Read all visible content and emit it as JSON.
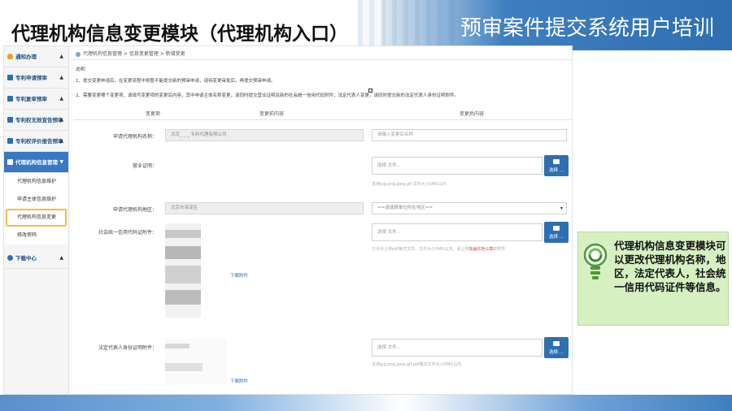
{
  "slide": {
    "title": "代理机构信息变更模块（代理机构入口）",
    "course_title": "预审案件提交系统用户培训"
  },
  "sidebar": {
    "items": [
      {
        "label": "通知办理",
        "icon": "bell-icon"
      },
      {
        "label": "专利申请预审",
        "icon": "document-icon"
      },
      {
        "label": "专利复审预审",
        "icon": "document-icon"
      },
      {
        "label": "专利权无效宣告预审",
        "icon": "document-icon"
      },
      {
        "label": "专利权评价报告预审",
        "icon": "document-icon"
      }
    ],
    "active_group": {
      "label": "代理机构信息管理",
      "subitems": [
        "代理机构信息维护",
        "申请主体信息维护",
        "代理机构信息变更",
        "修改密码"
      ],
      "selected_index": 2
    },
    "download": {
      "label": "下载中心"
    }
  },
  "main": {
    "breadcrumb": "代理机构信息管理 > 信息变更管理 > 新增变更",
    "notes": [
      "说明：",
      "1、提交变更申请后，在变更流程中将暂不能提交新的预审申请，请待变更审批后，再提交预审申请。",
      "2、需要变更哪个变更项，请填写变更项的变更后内容，其中申请主体名称变更，请同时提交营业证明及新的社会统一信用代码附件；法定代表人变更，请同时提交新的法定代表人身份证明附件。"
    ],
    "columns": [
      "变更项",
      "变更前内容",
      "变更后内容"
    ],
    "rows": {
      "name": {
        "label": "申请代理机构名称：",
        "old": "北京_ _ _ 专利代理有限公司",
        "placeholder": "请输入变更后名称"
      },
      "cert": {
        "label": "营业证明：",
        "file_placeholder": "选择 文件...",
        "hint": "支持jpg,png,jpeg,gif,文件大小5MG以内"
      },
      "region": {
        "label": "申请代理机构地区：",
        "old": "北京市海淀区",
        "select": "==请选择单位所在地区=="
      },
      "credit": {
        "label": "社会统一信用代码证附件：",
        "file_placeholder": "选择 文件...",
        "hint_pre": "只允许上传pdf格式文件，文件大小5MG以内，请上传",
        "hint_red": "加盖红色公章",
        "hint_post": "的附件",
        "download": "下载附件"
      },
      "legal": {
        "label": "法定代表人身份证明附件：",
        "file_placeholder": "选择 文件...",
        "hint": "支持jpg,png,jpeg,gif,pdf格式文件大小5MG以内",
        "download": "下载附件"
      }
    },
    "browse_label": "选择 ..."
  },
  "callout": {
    "text": "代理机构信息变更模块可以更改代理机构名称，地区，法定代表人，社会统一信用代码证件等信息。"
  }
}
